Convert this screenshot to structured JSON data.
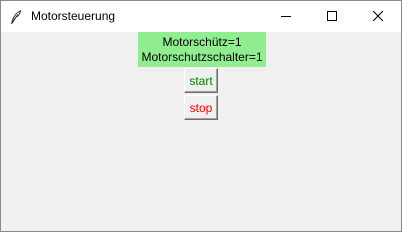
{
  "window": {
    "title": "Motorsteuerung"
  },
  "status": {
    "line1": "Motorschütz=1",
    "line2": "Motorschutzschalter=1",
    "background_color": "#90ee90"
  },
  "buttons": {
    "start": {
      "label": "start",
      "color": "#008000"
    },
    "stop": {
      "label": "stop",
      "color": "#ff0000"
    }
  },
  "icons": {
    "app": "feather-icon",
    "minimize": "minimize-icon",
    "maximize": "maximize-icon",
    "close": "close-icon"
  }
}
